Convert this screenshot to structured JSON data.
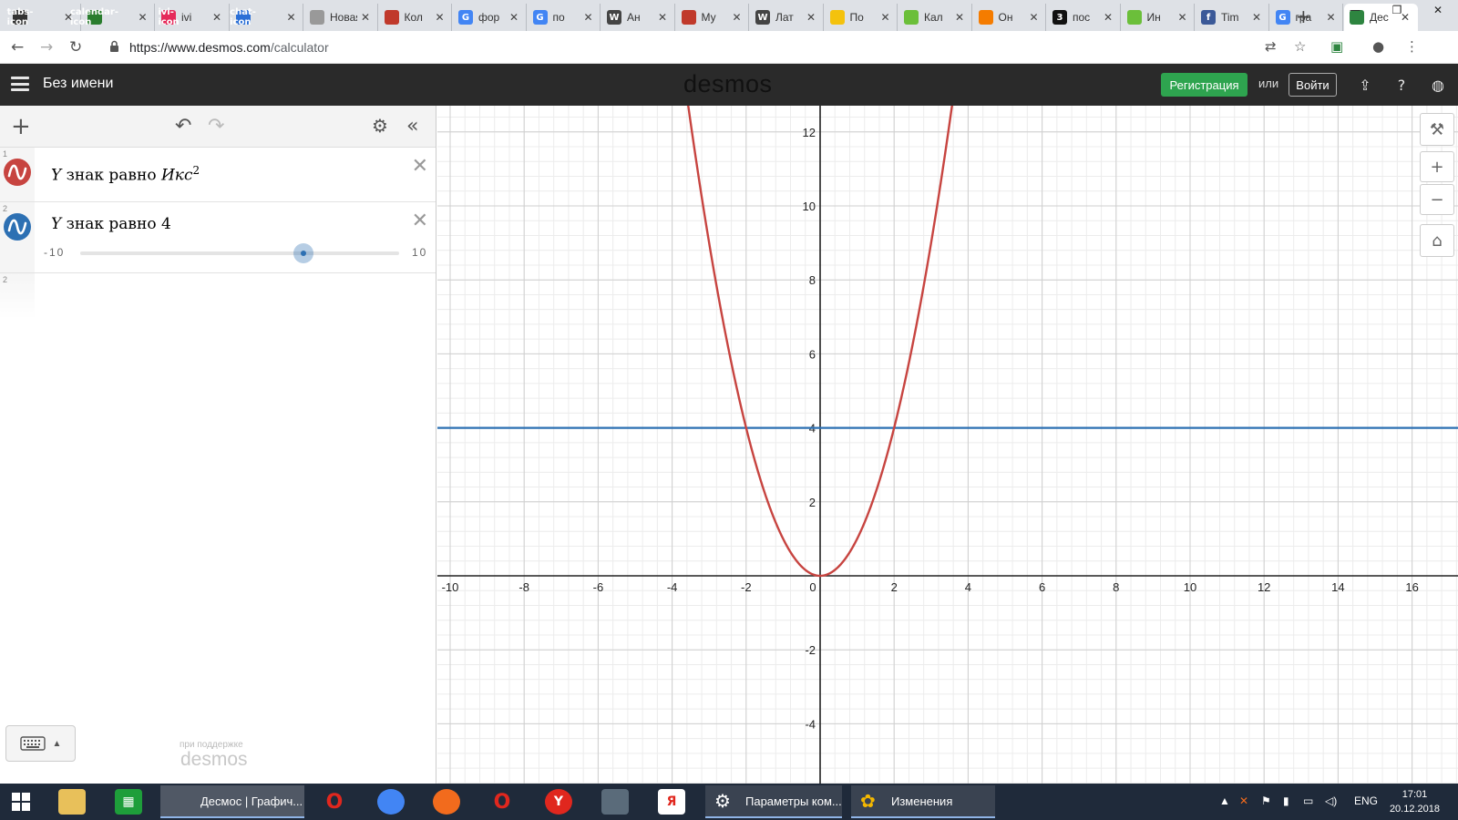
{
  "browser": {
    "tabs": [
      {
        "title": "",
        "icon": "tabs-icon",
        "color": "#333"
      },
      {
        "title": "",
        "icon": "calendar-icon",
        "color": "#2a7d2e"
      },
      {
        "title": "ivi",
        "icon": "ivi-icon",
        "color": "#e52a5a"
      },
      {
        "title": "",
        "icon": "chat-icon",
        "color": "#2b6fd6"
      },
      {
        "title": "Новая в",
        "icon": "",
        "color": "#999"
      },
      {
        "title": "Кол",
        "icon": "",
        "color": "#c0392b"
      },
      {
        "title": "фор",
        "icon": "G",
        "color": "#4285f4"
      },
      {
        "title": "по",
        "icon": "G",
        "color": "#4285f4"
      },
      {
        "title": "Ан",
        "icon": "W",
        "color": "#444"
      },
      {
        "title": "Му",
        "icon": "",
        "color": "#c0392b"
      },
      {
        "title": "Лат",
        "icon": "W",
        "color": "#444"
      },
      {
        "title": "По",
        "icon": "",
        "color": "#f4c20d"
      },
      {
        "title": "Кал",
        "icon": "",
        "color": "#6bbf3a"
      },
      {
        "title": "Он",
        "icon": "",
        "color": "#f57c00"
      },
      {
        "title": "пос",
        "icon": "3",
        "color": "#111"
      },
      {
        "title": "Ин",
        "icon": "",
        "color": "#6bbf3a"
      },
      {
        "title": "Tim",
        "icon": "f",
        "color": "#3b5998"
      },
      {
        "title": "гра",
        "icon": "G",
        "color": "#4285f4"
      },
      {
        "title": "Дес",
        "icon": "",
        "color": "#2e8540"
      }
    ],
    "url_host": "https://www.desmos.com",
    "url_path": "/calculator"
  },
  "header": {
    "doc_title": "Без имени",
    "logo": "desmos",
    "signup_label": "Регистрация",
    "or_label": "или",
    "login_label": "Войти"
  },
  "expressions": [
    {
      "index": "1",
      "var": "Y",
      "text": " знак равно ",
      "rhs_var": "Икс",
      "exponent": "2",
      "color": "#c74440"
    },
    {
      "index": "2",
      "var": "Y",
      "text": " знак равно ",
      "value": "4",
      "color": "#2d70b3",
      "slider": {
        "min": "-10",
        "max": "10",
        "value": 4
      }
    }
  ],
  "empty_row_index": "2",
  "powered_by": "при поддержке",
  "powered_logo": "desmos",
  "graph": {
    "x_ticks": [
      "-10",
      "-8",
      "-6",
      "-4",
      "-2",
      "0",
      "2",
      "4",
      "6",
      "8",
      "10",
      "12",
      "14",
      "16"
    ],
    "y_ticks": [
      "12",
      "10",
      "8",
      "6",
      "4",
      "2",
      "-2",
      "-4"
    ],
    "parabola_color": "#c74440",
    "line_color": "#2d70b3",
    "line_y": 4
  },
  "taskbar": {
    "apps": [
      {
        "label": "Десмос | Графич..."
      },
      {
        "label": "Параметры ком..."
      },
      {
        "label": "Изменения"
      }
    ],
    "lang": "ENG",
    "time": "17:01",
    "date": "20.12.2018"
  }
}
